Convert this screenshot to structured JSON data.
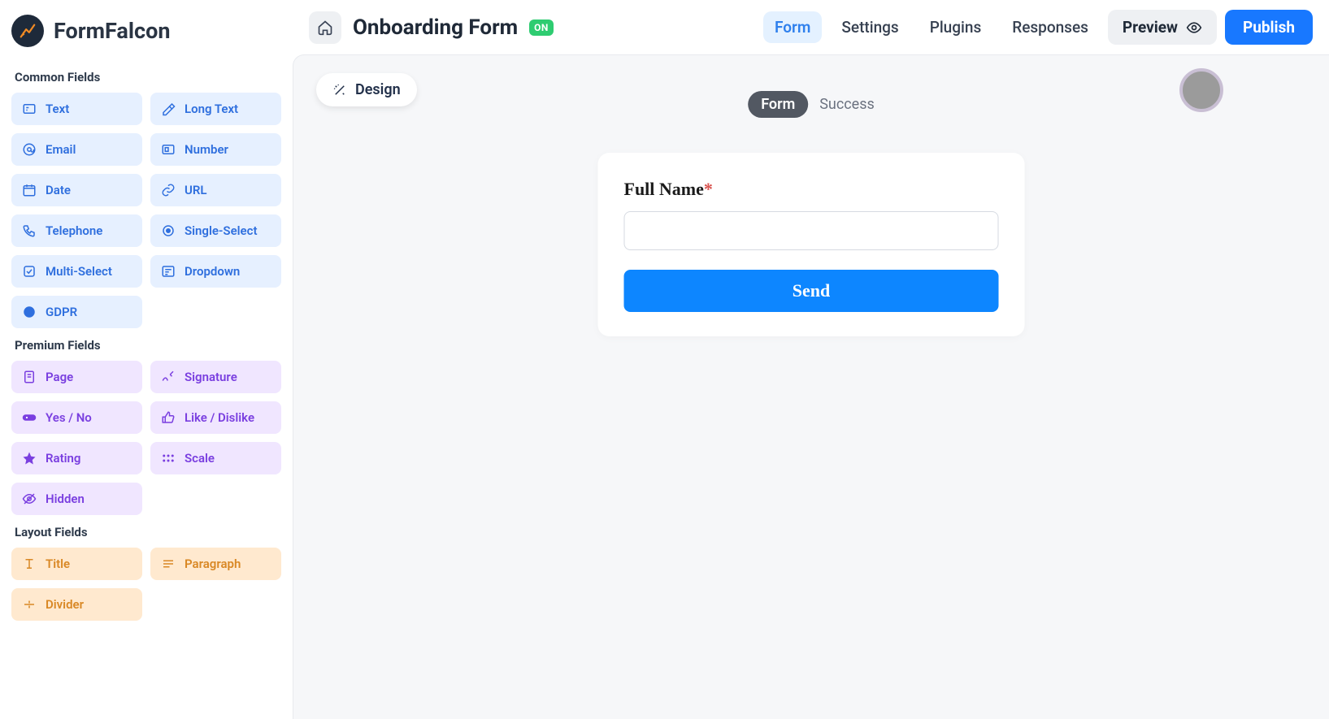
{
  "app": {
    "name": "FormFalcon"
  },
  "header": {
    "title": "Onboarding Form",
    "status_badge": "ON",
    "tabs": {
      "form": "Form",
      "settings": "Settings",
      "plugins": "Plugins",
      "responses": "Responses"
    },
    "preview_label": "Preview",
    "publish_label": "Publish"
  },
  "sidebar": {
    "sections": {
      "common": {
        "title": "Common Fields",
        "items": {
          "text": "Text",
          "long_text": "Long Text",
          "email": "Email",
          "number": "Number",
          "date": "Date",
          "url": "URL",
          "telephone": "Telephone",
          "single_select": "Single-Select",
          "multi_select": "Multi-Select",
          "dropdown": "Dropdown",
          "gdpr": "GDPR"
        }
      },
      "premium": {
        "title": "Premium Fields",
        "items": {
          "page": "Page",
          "signature": "Signature",
          "yes_no": "Yes / No",
          "like_dislike": "Like / Dislike",
          "rating": "Rating",
          "scale": "Scale",
          "hidden": "Hidden"
        }
      },
      "layout": {
        "title": "Layout Fields",
        "items": {
          "title": "Title",
          "paragraph": "Paragraph",
          "divider": "Divider"
        }
      }
    }
  },
  "canvas": {
    "design_label": "Design",
    "view_tabs": {
      "form": "Form",
      "success": "Success"
    },
    "form": {
      "field_label": "Full Name",
      "required_mark": "*",
      "submit_label": "Send"
    }
  }
}
